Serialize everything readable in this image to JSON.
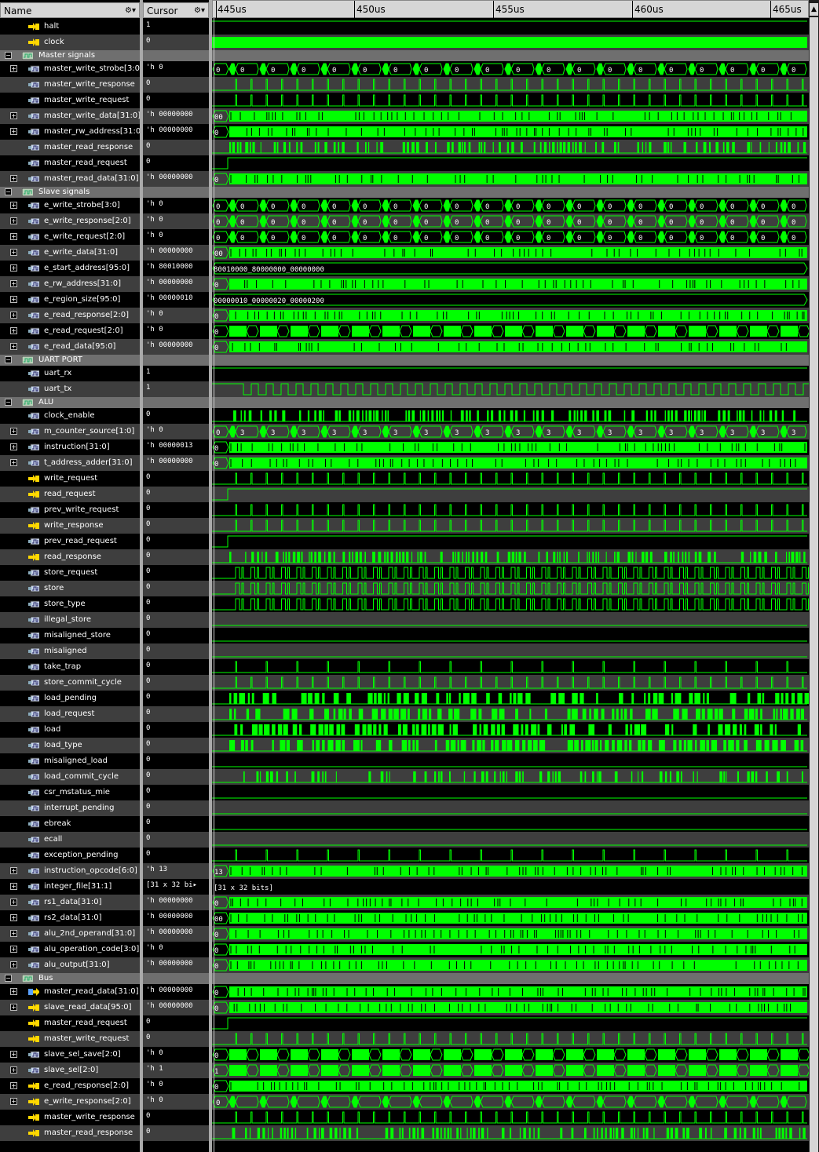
{
  "headers": {
    "name": "Name",
    "cursor": "Cursor"
  },
  "time_markers": [
    "445us",
    "450us",
    "455us",
    "460us",
    "465us"
  ],
  "icons": {
    "expand": "plus-box-icon",
    "collapse": "minus-box-icon",
    "group": "group-icon",
    "signal": "wave-signal-icon",
    "input": "input-arrow-icon",
    "output": "output-arrow-icon",
    "settings": "gear-icon",
    "menu": "dropdown-arrow-icon",
    "scroll": "scroll-up-arrow-icon"
  },
  "colors": {
    "wave": "#00ff00",
    "group_row": "#6f6f6f",
    "alt_row": "#3e3e3e",
    "header": "#d6d6d6"
  },
  "rows": [
    {
      "name": "halt",
      "value": "1",
      "kind": "sig",
      "icon": "in",
      "wave": "high",
      "indent": 1
    },
    {
      "name": "clock",
      "value": "0",
      "kind": "sig",
      "icon": "in",
      "wave": "clock",
      "indent": 1
    },
    {
      "name": "Master signals",
      "kind": "group"
    },
    {
      "name": "master_write_strobe[3:0]",
      "value": "'h 0",
      "kind": "bus",
      "icon": "sig",
      "wave": "strobe",
      "label0": "0",
      "labels": "0"
    },
    {
      "name": "master_write_response",
      "value": "0",
      "kind": "sig",
      "icon": "sig",
      "wave": "pulse"
    },
    {
      "name": "master_write_request",
      "value": "0",
      "kind": "sig",
      "icon": "sig",
      "wave": "pulse"
    },
    {
      "name": "master_write_data[31:0]",
      "value": "'h 00000000",
      "kind": "bus",
      "icon": "sig",
      "wave": "dense",
      "label0": "00"
    },
    {
      "name": "master_rw_address[31:0]",
      "value": "'h 00000000",
      "kind": "bus",
      "icon": "sig",
      "wave": "dense",
      "label0": "0"
    },
    {
      "name": "master_read_response",
      "value": "0",
      "kind": "sig",
      "icon": "sig",
      "wave": "densepulse"
    },
    {
      "name": "master_read_request",
      "value": "0",
      "kind": "sig",
      "icon": "sig",
      "wave": "rise"
    },
    {
      "name": "master_read_data[31:0]",
      "value": "'h 00000000",
      "kind": "bus",
      "icon": "sig",
      "wave": "dense",
      "label0": "0"
    },
    {
      "name": "Slave signals",
      "kind": "group"
    },
    {
      "name": "e_write_strobe[3:0]",
      "value": "'h 0",
      "kind": "bus",
      "icon": "sig",
      "wave": "strobe",
      "label0": "0",
      "labels": "0"
    },
    {
      "name": "e_write_response[2:0]",
      "value": "'h 0",
      "kind": "bus",
      "icon": "sig",
      "wave": "strobe",
      "label0": "0",
      "labels": "0"
    },
    {
      "name": "e_write_request[2:0]",
      "value": "'h 0",
      "kind": "bus",
      "icon": "sig",
      "wave": "strobe",
      "label0": "0",
      "labels": "0"
    },
    {
      "name": "e_write_data[31:0]",
      "value": "'h 00000000",
      "kind": "bus",
      "icon": "sig",
      "wave": "dense",
      "label0": "00"
    },
    {
      "name": "e_start_address[95:0]",
      "value": "'h 80010000",
      "kind": "bus",
      "icon": "sig",
      "wave": "const",
      "label0": "80010000_80000000_00000000"
    },
    {
      "name": "e_rw_address[31:0]",
      "value": "'h 00000000",
      "kind": "bus",
      "icon": "sig",
      "wave": "dense",
      "label0": "0"
    },
    {
      "name": "e_region_size[95:0]",
      "value": "'h 00000010",
      "kind": "bus",
      "icon": "sig",
      "wave": "const",
      "label0": "00000010_00000020_00000200"
    },
    {
      "name": "e_read_response[2:0]",
      "value": "'h 0",
      "kind": "bus",
      "icon": "sig",
      "wave": "dense",
      "label0": "0"
    },
    {
      "name": "e_read_request[2:0]",
      "value": "'h 0",
      "kind": "bus",
      "icon": "sig",
      "wave": "mixed",
      "label0": "0"
    },
    {
      "name": "e_read_data[95:0]",
      "value": "'h 00000000",
      "kind": "bus",
      "icon": "sig",
      "wave": "dense",
      "label0": "0"
    },
    {
      "name": "UART PORT",
      "kind": "group"
    },
    {
      "name": "uart_rx",
      "value": "1",
      "kind": "sig",
      "icon": "sig",
      "wave": "high"
    },
    {
      "name": "uart_tx",
      "value": "1",
      "kind": "sig",
      "icon": "sig",
      "wave": "uart"
    },
    {
      "name": "ALU",
      "kind": "group"
    },
    {
      "name": "clock_enable",
      "value": "0",
      "kind": "sig",
      "icon": "sig",
      "wave": "densepulse"
    },
    {
      "name": "m_counter_source[1:0]",
      "value": "'h 0",
      "kind": "bus",
      "icon": "sig",
      "wave": "strobe",
      "label0": "0",
      "labels": "3"
    },
    {
      "name": "instruction[31:0]",
      "value": "'h 00000013",
      "kind": "bus",
      "icon": "sig",
      "wave": "dense",
      "label0": "0"
    },
    {
      "name": "t_address_adder[31:0]",
      "value": "'h 00000000",
      "kind": "bus",
      "icon": "sig",
      "wave": "dense",
      "label0": "0"
    },
    {
      "name": "write_request",
      "value": "0",
      "kind": "sig",
      "icon": "in",
      "wave": "pulse"
    },
    {
      "name": "read_request",
      "value": "0",
      "kind": "sig",
      "icon": "in",
      "wave": "rise"
    },
    {
      "name": "prev_write_request",
      "value": "0",
      "kind": "sig",
      "icon": "sig",
      "wave": "pulse"
    },
    {
      "name": "write_response",
      "value": "0",
      "kind": "sig",
      "icon": "in",
      "wave": "pulse"
    },
    {
      "name": "prev_read_request",
      "value": "0",
      "kind": "sig",
      "icon": "sig",
      "wave": "rise"
    },
    {
      "name": "read_response",
      "value": "0",
      "kind": "sig",
      "icon": "in",
      "wave": "densepulse"
    },
    {
      "name": "store_request",
      "value": "0",
      "kind": "sig",
      "icon": "sig",
      "wave": "doublepulse"
    },
    {
      "name": "store",
      "value": "0",
      "kind": "sig",
      "icon": "sig",
      "wave": "doublepulse"
    },
    {
      "name": "store_type",
      "value": "0",
      "kind": "sig",
      "icon": "sig",
      "wave": "doublepulse"
    },
    {
      "name": "illegal_store",
      "value": "0",
      "kind": "sig",
      "icon": "sig",
      "wave": "low"
    },
    {
      "name": "misaligned_store",
      "value": "0",
      "kind": "sig",
      "icon": "sig",
      "wave": "low"
    },
    {
      "name": "misaligned",
      "value": "0",
      "kind": "sig",
      "icon": "sig",
      "wave": "low"
    },
    {
      "name": "take_trap",
      "value": "0",
      "kind": "sig",
      "icon": "sig",
      "wave": "sparse"
    },
    {
      "name": "store_commit_cycle",
      "value": "0",
      "kind": "sig",
      "icon": "sig",
      "wave": "pulse"
    },
    {
      "name": "load_pending",
      "value": "0",
      "kind": "sig",
      "icon": "sig",
      "wave": "blocks"
    },
    {
      "name": "load_request",
      "value": "0",
      "kind": "sig",
      "icon": "sig",
      "wave": "blocks"
    },
    {
      "name": "load",
      "value": "0",
      "kind": "sig",
      "icon": "sig",
      "wave": "blocks"
    },
    {
      "name": "load_type",
      "value": "0",
      "kind": "sig",
      "icon": "sig",
      "wave": "blocks"
    },
    {
      "name": "misaligned_load",
      "value": "0",
      "kind": "sig",
      "icon": "sig",
      "wave": "low"
    },
    {
      "name": "load_commit_cycle",
      "value": "0",
      "kind": "sig",
      "icon": "sig",
      "wave": "densepulse2"
    },
    {
      "name": "csr_mstatus_mie",
      "value": "0",
      "kind": "sig",
      "icon": "sig",
      "wave": "low"
    },
    {
      "name": "interrupt_pending",
      "value": "0",
      "kind": "sig",
      "icon": "sig",
      "wave": "low"
    },
    {
      "name": "ebreak",
      "value": "0",
      "kind": "sig",
      "icon": "sig",
      "wave": "low"
    },
    {
      "name": "ecall",
      "value": "0",
      "kind": "sig",
      "icon": "sig",
      "wave": "low"
    },
    {
      "name": "exception_pending",
      "value": "0",
      "kind": "sig",
      "icon": "sig",
      "wave": "sparse"
    },
    {
      "name": "instruction_opcode[6:0]",
      "value": "'h 13",
      "kind": "bus",
      "icon": "sig",
      "wave": "dense",
      "label0": "13"
    },
    {
      "name": "integer_file[31:1]",
      "value": "[31 x 32 bi▸",
      "kind": "bus",
      "icon": "sig",
      "wave": "text",
      "label0": "[31 x 32 bits]"
    },
    {
      "name": "rs1_data[31:0]",
      "value": "'h 00000000",
      "kind": "bus",
      "icon": "sig",
      "wave": "dense",
      "label0": "0"
    },
    {
      "name": "rs2_data[31:0]",
      "value": "'h 00000000",
      "kind": "bus",
      "icon": "sig",
      "wave": "dense",
      "label0": "00"
    },
    {
      "name": "alu_2nd_operand[31:0]",
      "value": "'h 00000000",
      "kind": "bus",
      "icon": "sig",
      "wave": "dense",
      "label0": "0"
    },
    {
      "name": "alu_operation_code[3:0]",
      "value": "'h 0",
      "kind": "bus",
      "icon": "sig",
      "wave": "dense",
      "label0": "0"
    },
    {
      "name": "alu_output[31:0]",
      "value": "'h 00000000",
      "kind": "bus",
      "icon": "sig",
      "wave": "dense",
      "label0": "0"
    },
    {
      "name": "Bus",
      "kind": "group"
    },
    {
      "name": "master_read_data[31:0]",
      "value": "'h 00000000",
      "kind": "bus",
      "icon": "out",
      "wave": "dense",
      "label0": "0"
    },
    {
      "name": "slave_read_data[95:0]",
      "value": "'h 00000000",
      "kind": "bus",
      "icon": "in",
      "wave": "dense",
      "label0": "0"
    },
    {
      "name": "master_read_request",
      "value": "0",
      "kind": "sig",
      "icon": "in",
      "wave": "rise"
    },
    {
      "name": "master_write_request",
      "value": "0",
      "kind": "sig",
      "icon": "in",
      "wave": "pulse"
    },
    {
      "name": "slave_sel_save[2:0]",
      "value": "'h 0",
      "kind": "bus",
      "icon": "sig",
      "wave": "mixed",
      "label0": "0"
    },
    {
      "name": "slave_sel[2:0]",
      "value": "'h 1",
      "kind": "bus",
      "icon": "sig",
      "wave": "mixed",
      "label0": "1"
    },
    {
      "name": "e_read_response[2:0]",
      "value": "'h 0",
      "kind": "bus",
      "icon": "in",
      "wave": "dense",
      "label0": "0"
    },
    {
      "name": "e_write_response[2:0]",
      "value": "'h 0",
      "kind": "bus",
      "icon": "in",
      "wave": "strobe",
      "label0": "0",
      "labels": ""
    },
    {
      "name": "master_write_response",
      "value": "0",
      "kind": "sig",
      "icon": "in",
      "wave": "pulse"
    },
    {
      "name": "master_read_response",
      "value": "0",
      "kind": "sig",
      "icon": "in",
      "wave": "densepulse"
    }
  ]
}
